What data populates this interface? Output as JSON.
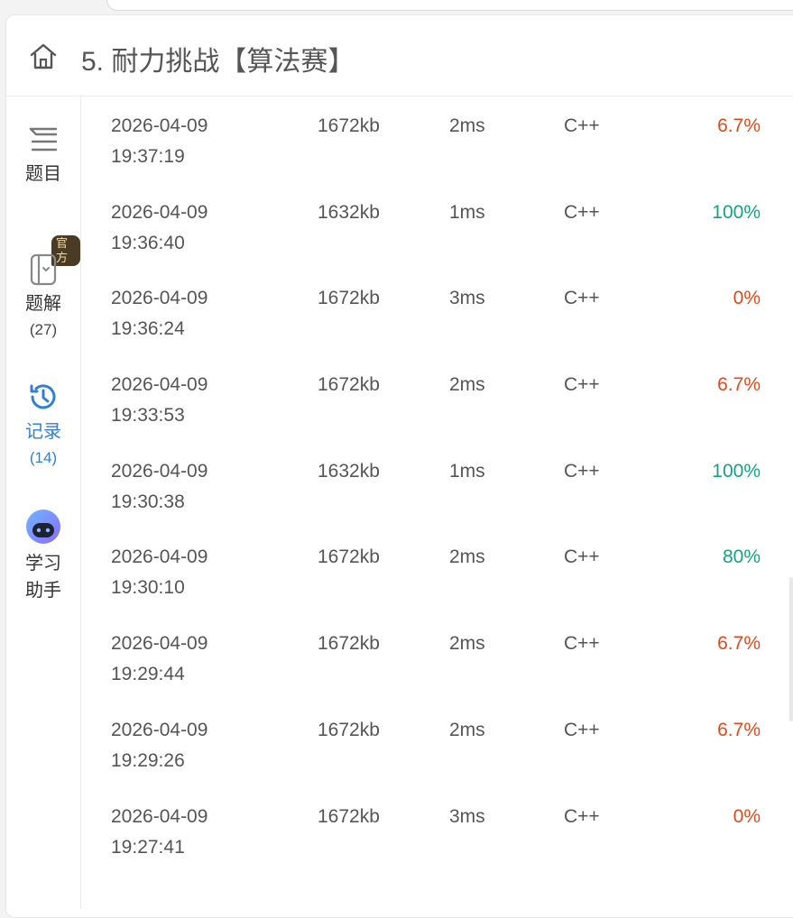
{
  "header": {
    "title": "5. 耐力挑战【算法赛】"
  },
  "sidebar": {
    "problem": {
      "label": "题目"
    },
    "solution": {
      "label": "题解",
      "count": "(27)",
      "badge": "官方"
    },
    "records": {
      "label": "记录",
      "count": "(14)"
    },
    "assistant": {
      "label": "学习\n助手"
    }
  },
  "colors": {
    "accent": "#2f7fd6",
    "fail": "#e04a1c",
    "pass": "#14a37f"
  },
  "records": [
    {
      "date": "2026-04-09",
      "time": "19:37:19",
      "memory": "1672kb",
      "runtime": "2ms",
      "lang": "C++",
      "score": "6.7%",
      "status": "low"
    },
    {
      "date": "2026-04-09",
      "time": "19:36:40",
      "memory": "1632kb",
      "runtime": "1ms",
      "lang": "C++",
      "score": "100%",
      "status": "high"
    },
    {
      "date": "2026-04-09",
      "time": "19:36:24",
      "memory": "1672kb",
      "runtime": "3ms",
      "lang": "C++",
      "score": "0%",
      "status": "low"
    },
    {
      "date": "2026-04-09",
      "time": "19:33:53",
      "memory": "1672kb",
      "runtime": "2ms",
      "lang": "C++",
      "score": "6.7%",
      "status": "low"
    },
    {
      "date": "2026-04-09",
      "time": "19:30:38",
      "memory": "1632kb",
      "runtime": "1ms",
      "lang": "C++",
      "score": "100%",
      "status": "high"
    },
    {
      "date": "2026-04-09",
      "time": "19:30:10",
      "memory": "1672kb",
      "runtime": "2ms",
      "lang": "C++",
      "score": "80%",
      "status": "high"
    },
    {
      "date": "2026-04-09",
      "time": "19:29:44",
      "memory": "1672kb",
      "runtime": "2ms",
      "lang": "C++",
      "score": "6.7%",
      "status": "low"
    },
    {
      "date": "2026-04-09",
      "time": "19:29:26",
      "memory": "1672kb",
      "runtime": "2ms",
      "lang": "C++",
      "score": "6.7%",
      "status": "low"
    },
    {
      "date": "2026-04-09",
      "time": "19:27:41",
      "memory": "1672kb",
      "runtime": "3ms",
      "lang": "C++",
      "score": "0%",
      "status": "low"
    }
  ]
}
